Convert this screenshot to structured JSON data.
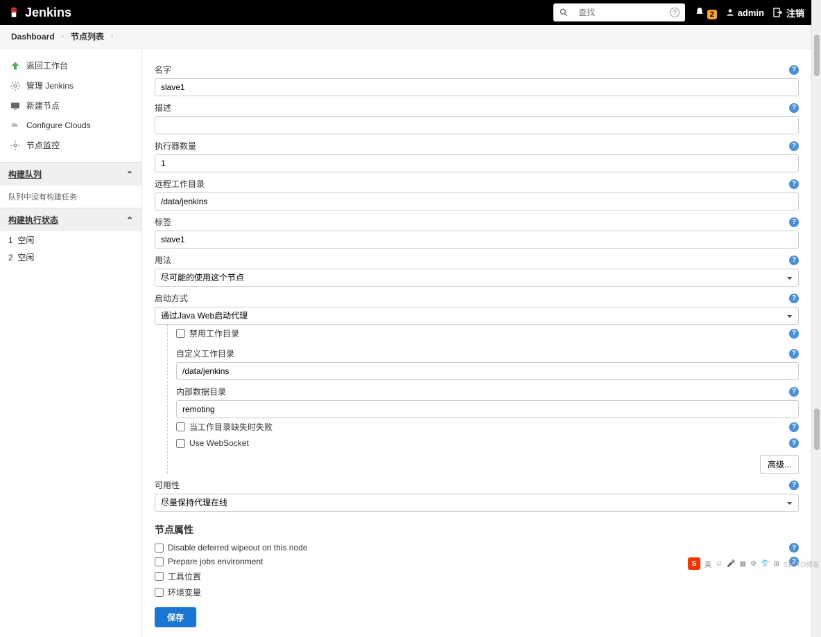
{
  "header": {
    "brand": "Jenkins",
    "search_placeholder": "查找",
    "notification_count": "2",
    "username": "admin",
    "logout": "注销"
  },
  "breadcrumbs": {
    "dashboard": "Dashboard",
    "nodes": "节点列表"
  },
  "sidebar": {
    "links": {
      "back": "返回工作台",
      "manage": "管理 Jenkins",
      "new_node": "新建节点",
      "configure_clouds": "Configure Clouds",
      "node_monitor": "节点监控"
    },
    "build_queue": {
      "title": "构建队列",
      "empty": "队列中没有构建任务"
    },
    "executor_status": {
      "title": "构建执行状态",
      "rows": [
        {
          "num": "1",
          "state": "空闲"
        },
        {
          "num": "2",
          "state": "空闲"
        }
      ]
    }
  },
  "form": {
    "name_label": "名字",
    "name_value": "slave1",
    "description_label": "描述",
    "description_value": "",
    "executors_label": "执行器数量",
    "executors_value": "1",
    "remote_root_label": "远程工作目录",
    "remote_root_value": "/data/jenkins",
    "labels_label": "标签",
    "labels_value": "slave1",
    "usage_label": "用法",
    "usage_value": "尽可能的使用这个节点",
    "launch_label": "启动方式",
    "launch_value": "通过Java Web启动代理",
    "disable_workdir_label": "禁用工作目录",
    "custom_workdir_label": "自定义工作目录",
    "custom_workdir_value": "/data/jenkins",
    "internal_data_label": "内部数据目录",
    "internal_data_value": "remoting",
    "fail_workdir_missing_label": "当工作目录缺失时失败",
    "use_websocket_label": "Use WebSocket",
    "advanced_btn": "高级...",
    "availability_label": "可用性",
    "availability_value": "尽量保持代理在线",
    "node_props_title": "节点属性",
    "node_props": {
      "disable_wipeout": "Disable deferred wipeout on this node",
      "prepare_jobs": "Prepare jobs environment",
      "tool_location": "工具位置",
      "env_vars": "环境变量"
    },
    "save_btn": "保存"
  },
  "taskbar": {
    "ime": "英",
    "watermark": "51CTO博客"
  }
}
